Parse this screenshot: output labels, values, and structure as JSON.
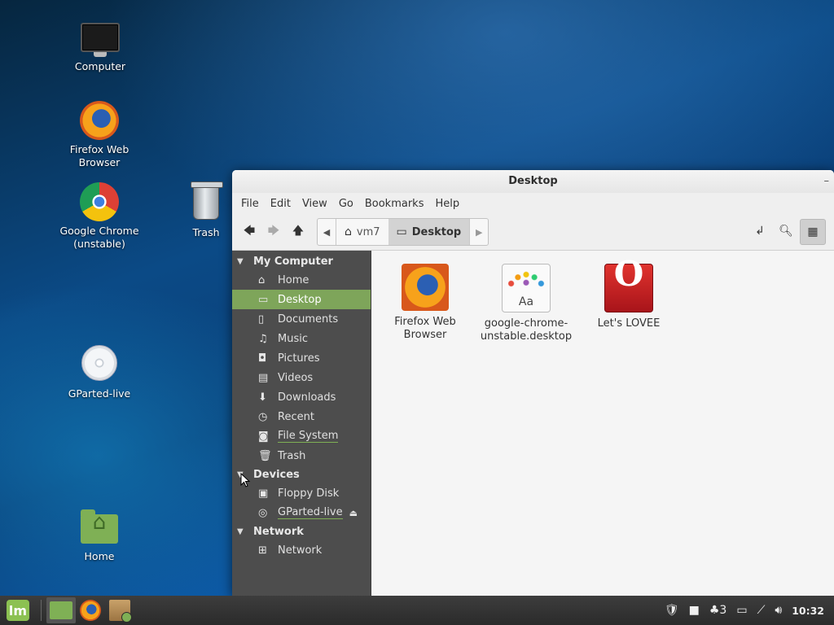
{
  "desktop": {
    "icons": {
      "computer": "Computer",
      "firefox_line1": "Firefox Web",
      "firefox_line2": "Browser",
      "chrome_line1": "Google Chrome",
      "chrome_line2": "(unstable)",
      "trash": "Trash",
      "gparted": "GParted-live",
      "home": "Home"
    }
  },
  "window": {
    "title": "Desktop",
    "menu": [
      "File",
      "Edit",
      "View",
      "Go",
      "Bookmarks",
      "Help"
    ],
    "breadcrumbs": {
      "home": "vm7",
      "current": "Desktop"
    },
    "sidebar": {
      "my_computer": {
        "title": "My Computer",
        "items": [
          "Home",
          "Desktop",
          "Documents",
          "Music",
          "Pictures",
          "Videos",
          "Downloads",
          "Recent",
          "File System",
          "Trash"
        ]
      },
      "devices": {
        "title": "Devices",
        "items": [
          "Floppy Disk",
          "GParted-live"
        ]
      },
      "network": {
        "title": "Network",
        "items": [
          "Network"
        ]
      },
      "selected": "Desktop"
    },
    "files": [
      {
        "line1": "Firefox Web",
        "line2": "Browser",
        "icon": "firefox-icon"
      },
      {
        "line1": "google-chrome-",
        "line2": "unstable.desktop",
        "icon": "font-desktop-file-icon"
      },
      {
        "line1": "Let's LOVEE",
        "line2": "",
        "icon": "opera-icon"
      }
    ]
  },
  "panel": {
    "menu_logo": "lm",
    "tray": {
      "notification_count": "3",
      "clock": "10:32"
    }
  },
  "colors": {
    "accent_green": "#7ea55a",
    "sidebar_bg": "#4d4d4d",
    "panel_bg": "#2b2b2b"
  }
}
